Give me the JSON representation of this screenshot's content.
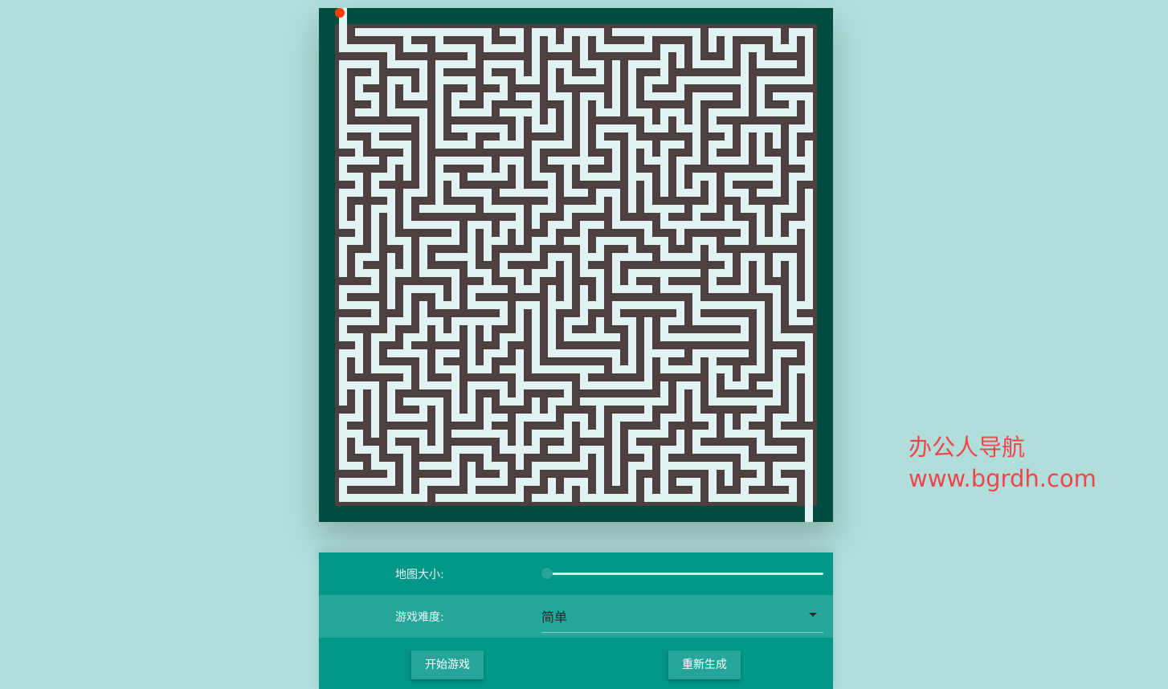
{
  "game": {
    "name": "maze",
    "grid_size": 30,
    "player": {
      "row": 0,
      "col": 0
    },
    "entrance": {
      "row": 0,
      "col": 0
    },
    "exit": {
      "row": 29,
      "col": 29
    },
    "colors": {
      "border": "#004d40",
      "wall": "#4e4040",
      "path": "#e0f2f1",
      "player": "#ff3d00"
    }
  },
  "watermark": {
    "line1": "办公人导航",
    "line2": "www.bgrdh.com",
    "color": "#f0454a"
  },
  "controls": {
    "map_size_label": "地图大小:",
    "map_size_value_fraction": 0.02,
    "difficulty_label": "游戏难度:",
    "difficulty_value": "简单",
    "start_button": "开始游戏",
    "regenerate_button": "重新生成"
  }
}
